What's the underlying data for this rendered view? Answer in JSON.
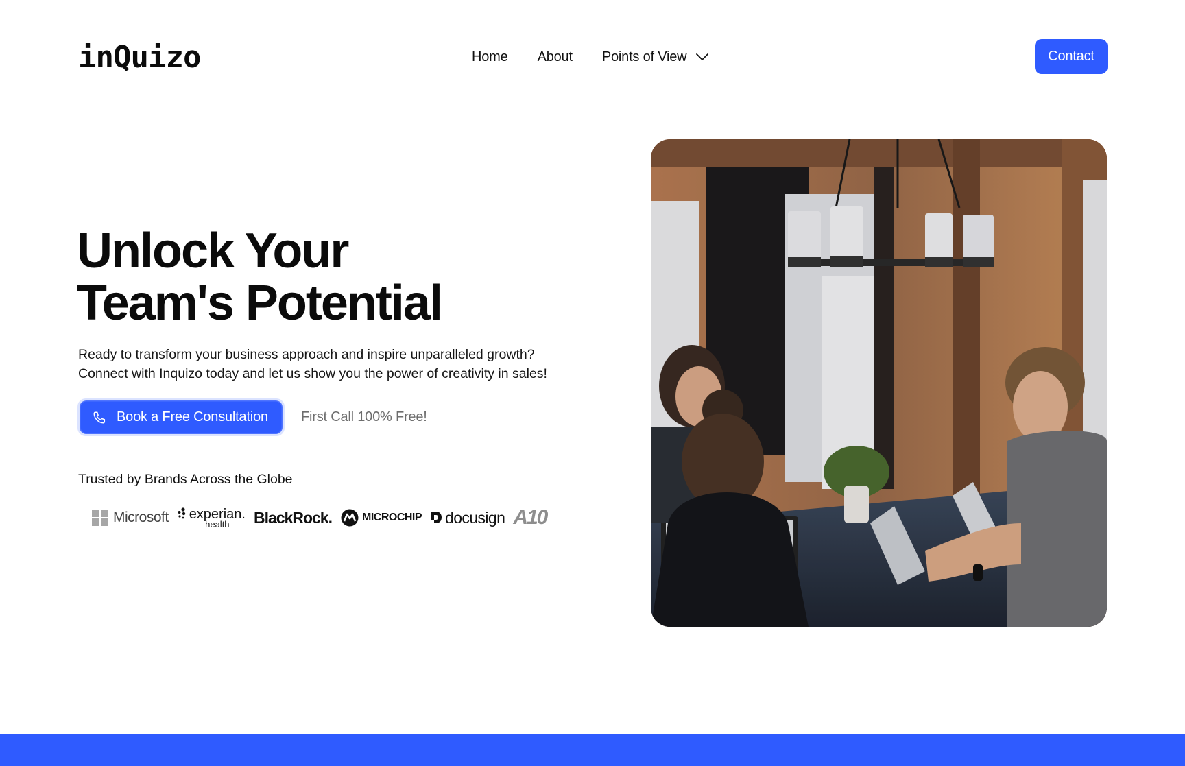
{
  "header": {
    "logo_text": "inQuizo",
    "nav": [
      {
        "label": "Home"
      },
      {
        "label": "About"
      },
      {
        "label": "Points of View",
        "has_dropdown": true
      }
    ],
    "contact_label": "Contact"
  },
  "hero": {
    "title_line1": "Unlock Your",
    "title_line2": "Team's Potential",
    "subtitle_line1": "Ready to transform your business approach and inspire unparalleled growth?",
    "subtitle_line2": "Connect with Inquizo today and let us show you the power of creativity in sales!",
    "cta_label": "Book a Free Consultation",
    "cta_note": "First Call 100% Free!",
    "trusted_label": "Trusted by Brands Across the Globe",
    "brands": [
      {
        "name": "Microsoft"
      },
      {
        "name": "experian.",
        "sub": "health"
      },
      {
        "name": "BlackRock."
      },
      {
        "name": "MICROCHIP"
      },
      {
        "name": "docusign"
      },
      {
        "name": "A10"
      }
    ]
  },
  "image": {
    "alt": "team-meeting-photo",
    "icon": "photo-icon"
  },
  "colors": {
    "accent": "#2f5bff",
    "text": "#0b0b0b",
    "muted": "#6d6d6d"
  }
}
